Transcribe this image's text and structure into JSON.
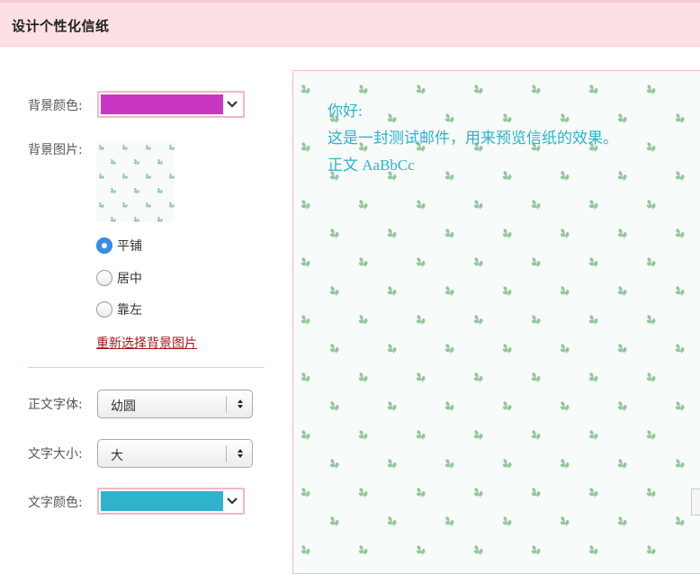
{
  "header": {
    "title": "设计个性化信纸"
  },
  "form": {
    "bg_color": {
      "label": "背景颜色:",
      "color": "#c936c4",
      "border_color": "#f2b7c4"
    },
    "bg_image": {
      "label": "背景图片:",
      "options": [
        {
          "label": "平铺",
          "checked": true
        },
        {
          "label": "居中",
          "checked": false
        },
        {
          "label": "靠左",
          "checked": false
        }
      ],
      "reselect_link": "重新选择背景图片"
    },
    "font": {
      "label": "正文字体:",
      "value": "幼圆"
    },
    "size": {
      "label": "文字大小:",
      "value": "大"
    },
    "text_color": {
      "label": "文字颜色:",
      "color": "#2fb2cb"
    }
  },
  "preview": {
    "greeting": "你好:",
    "body": "这是一封测试邮件，用来预览信纸的效果。",
    "sample": "正文 AaBbCc",
    "text_color": "#2bb3cc",
    "bg_color": "#f7fbf9",
    "motif_color": "#8fc79a"
  }
}
